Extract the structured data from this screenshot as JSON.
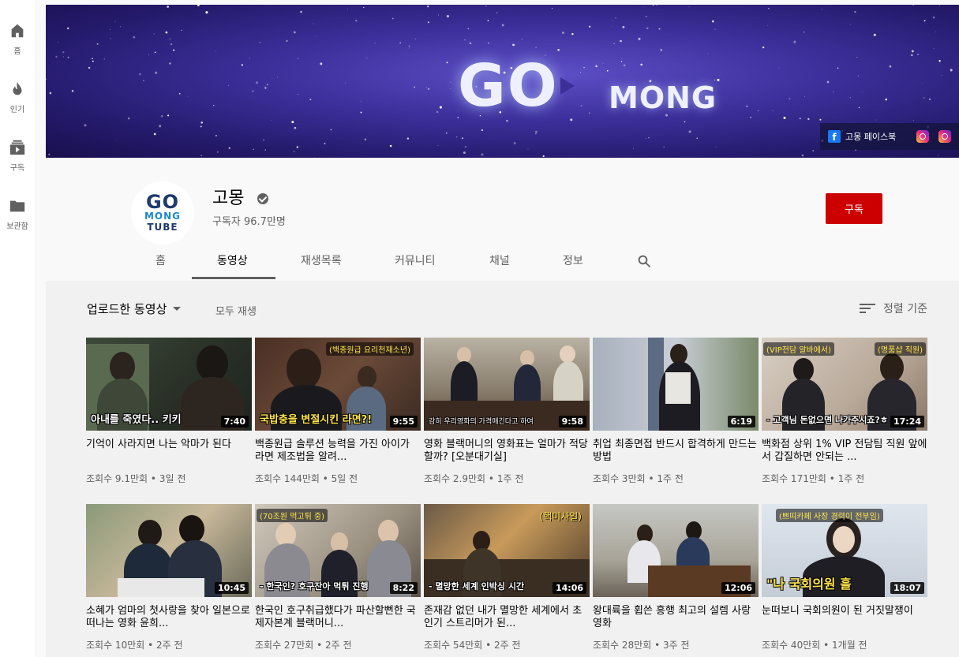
{
  "guide": [
    {
      "label": "홈",
      "icon": "home-icon"
    },
    {
      "label": "인기",
      "icon": "trending-icon"
    },
    {
      "label": "구독",
      "icon": "subscriptions-icon"
    },
    {
      "label": "보관함",
      "icon": "library-icon"
    }
  ],
  "banner": {
    "logo_go": "GO",
    "logo_mong": "MONG",
    "facebook_label": "고몽 페이스북"
  },
  "channel": {
    "name": "고몽",
    "subscribers": "구독자 96.7만명",
    "avatar_line1": "GO",
    "avatar_line2": "MONG",
    "avatar_line3": "TUBE",
    "subscribe_label": "구독"
  },
  "tabs": [
    "홈",
    "동영상",
    "재생목록",
    "커뮤니티",
    "채널",
    "정보"
  ],
  "active_tab": "동영상",
  "toolbar": {
    "uploaded_label": "업로드한 동영상",
    "play_all_label": "모두 재생",
    "sort_label": "정렬 기준"
  },
  "colors": {
    "subscribe": "#cc0000",
    "caption_yellow": "#ffe54a"
  },
  "videos": [
    {
      "title": "기억이 사라지면 나는 악마가 된다",
      "views": "조회수 9.1만회",
      "age": "3일 전",
      "duration": "7:40",
      "caption": "아내를 죽였다.. 키키",
      "tag": ""
    },
    {
      "title": "백종원급 솔루션 능력을 가진 아이가 라면 제조법을 알려...",
      "views": "조회수 144만회",
      "age": "5일 전",
      "duration": "9:55",
      "caption": "국밥충을 변절시킨 라면?!",
      "tag": "(백종원급 요리천재소년)"
    },
    {
      "title": "영화 블랙머니의 영화표는 얼마가 적당할까? [오분대기실]",
      "views": "조회수 2.9만회",
      "age": "1주 전",
      "duration": "9:58",
      "caption": "감히 우리영화의 가격매긴다고 하여",
      "tag": ""
    },
    {
      "title": "취업 최종면접 반드시 합격하게 만드는 방법",
      "views": "조회수 3만회",
      "age": "1주 전",
      "duration": "6:19",
      "caption": "",
      "tag": ""
    },
    {
      "title": "백화점 상위 1% VIP 전담팀 직원 앞에서 갑질하면 안되는 ...",
      "views": "조회수 171만회",
      "age": "1주 전",
      "duration": "17:24",
      "caption": "- 고객님 돈없으면 나가주시죠?ㅎ",
      "tag": "(VIP전담 알바에서)"
    },
    {
      "title": "소혜가 엄마의 첫사랑을 찾아 일본으로 떠나는 영화 윤희...",
      "views": "조회수 10만회",
      "age": "2주 전",
      "duration": "10:45",
      "caption": "",
      "tag": ""
    },
    {
      "title": "한국인 호구취급했다가 파산할뻔한 국제자본계 블랙머니...",
      "views": "조회수 27만회",
      "age": "2주 전",
      "duration": "8:22",
      "caption": "- 한국인? 호구잔아 먹튀 진행",
      "tag": "(70조원 먹고튀 중)"
    },
    {
      "title": "존재감 없던 내가 멸망한 세계에서 초인기 스트리머가 된...",
      "views": "조회수 54만회",
      "age": "2주 전",
      "duration": "14:06",
      "caption": "- 멸망한 세계 인박싱 시간",
      "tag": "(핵미사일)"
    },
    {
      "title": "왕대륙을 휩쓴 흥행 최고의 설렘 사랑 영화",
      "views": "조회수 28만회",
      "age": "3주 전",
      "duration": "12:06",
      "caption": "",
      "tag": ""
    },
    {
      "title": "눈떠보니 국회의원이 된 거짓말쟁이",
      "views": "조회수 40만회",
      "age": "1개월 전",
      "duration": "18:07",
      "caption": "\"나 국회의원 흘",
      "tag": "(쁘띠카페 사장 경력이 전부임)"
    }
  ]
}
